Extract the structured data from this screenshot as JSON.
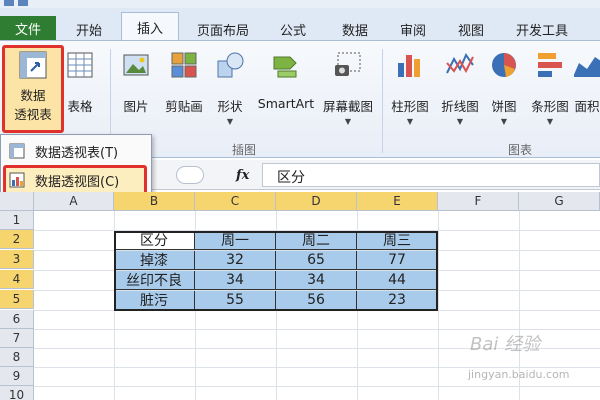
{
  "tabs": {
    "file": "文件",
    "items": [
      "开始",
      "插入",
      "页面布局",
      "公式",
      "数据",
      "审阅",
      "视图",
      "开发工具"
    ],
    "active": "插入"
  },
  "ribbon": {
    "pivot_label_1": "数据",
    "pivot_label_2": "透视表",
    "table_label": "表格",
    "picture_label": "图片",
    "clipart_label": "剪贴画",
    "shapes_label": "形状",
    "smartart_label": "SmartArt",
    "screenshot_label": "屏幕截图",
    "column_label": "柱形图",
    "line_label": "折线图",
    "pie_label": "饼图",
    "bar_label": "条形图",
    "area_label": "面积",
    "group_illustrations": "插图",
    "group_charts": "图表"
  },
  "dropdown": {
    "item1": "数据透视表(T)",
    "item2": "数据透视图(C)"
  },
  "formula_bar": {
    "fx": "fx",
    "content": "区分"
  },
  "sheet": {
    "columns": [
      "A",
      "B",
      "C",
      "D",
      "E",
      "F",
      "G"
    ],
    "rows": [
      "1",
      "2",
      "3",
      "4",
      "5",
      "6",
      "7",
      "8",
      "9",
      "10"
    ],
    "table": {
      "header": [
        "区分",
        "周一",
        "周二",
        "周三"
      ],
      "rows": [
        [
          "掉漆",
          "32",
          "65",
          "77"
        ],
        [
          "丝印不良",
          "34",
          "34",
          "44"
        ],
        [
          "脏污",
          "55",
          "56",
          "23"
        ]
      ]
    }
  },
  "watermark": {
    "text": "Bai 经验",
    "sub": "jingyan.baidu.com"
  },
  "colors": {
    "file_tab": "#2e7d32",
    "highlight_border": "#e0312c",
    "selected_header": "#f6d46e",
    "table_blue": "#a9cbeb"
  }
}
